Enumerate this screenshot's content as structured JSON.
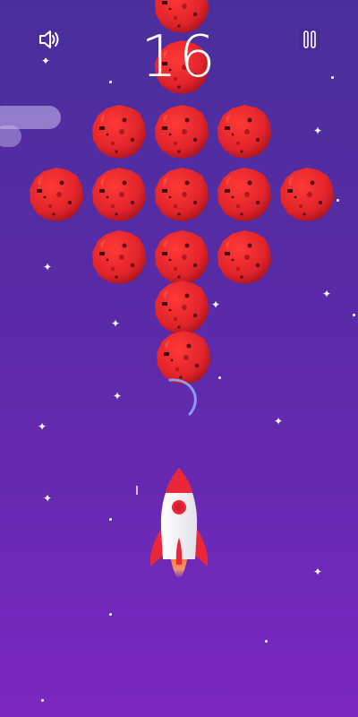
{
  "hud": {
    "score": "16",
    "sound_icon": "speaker-volume-icon",
    "pause_icon": "pause-icon"
  },
  "colors": {
    "background_top": "#4a2f9c",
    "background_bottom": "#7b28c0",
    "asteroid": "#e0232b",
    "rocket_body": "#ffffff",
    "rocket_accent": "#e8283a",
    "flame": "#ff8a3d"
  },
  "icons": [
    "speaker-volume-icon",
    "pause-icon",
    "asteroid-icon",
    "rocket-icon",
    "star-icon"
  ]
}
